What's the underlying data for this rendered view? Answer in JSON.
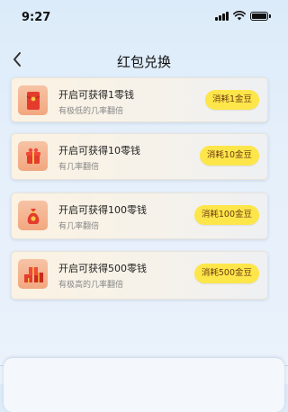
{
  "status_bar": {
    "time": "9:27",
    "icons": [
      "signal-icon",
      "wifi-icon",
      "battery-icon"
    ]
  },
  "nav": {
    "title": "红包兑换",
    "back_icon": "chevron-left-icon"
  },
  "colors": {
    "button_bg": "#fde64a",
    "button_text": "#6b3a12",
    "card_bg": "#fbf2e2"
  },
  "items": [
    {
      "title": "开启可获得1零钱",
      "subtitle": "有极低的几率翻倍",
      "button": "消耗1金豆",
      "icon": "red-envelope-icon"
    },
    {
      "title": "开启可获得10零钱",
      "subtitle": "有几率翻倍",
      "button": "消耗10金豆",
      "icon": "gift-box-icon"
    },
    {
      "title": "开启可获得100零钱",
      "subtitle": "有几率翻倍",
      "button": "消耗100金豆",
      "icon": "money-bag-icon"
    },
    {
      "title": "开启可获得500零钱",
      "subtitle": "有极高的几率翻倍",
      "button": "消耗500金豆",
      "icon": "gift-pile-icon"
    }
  ]
}
